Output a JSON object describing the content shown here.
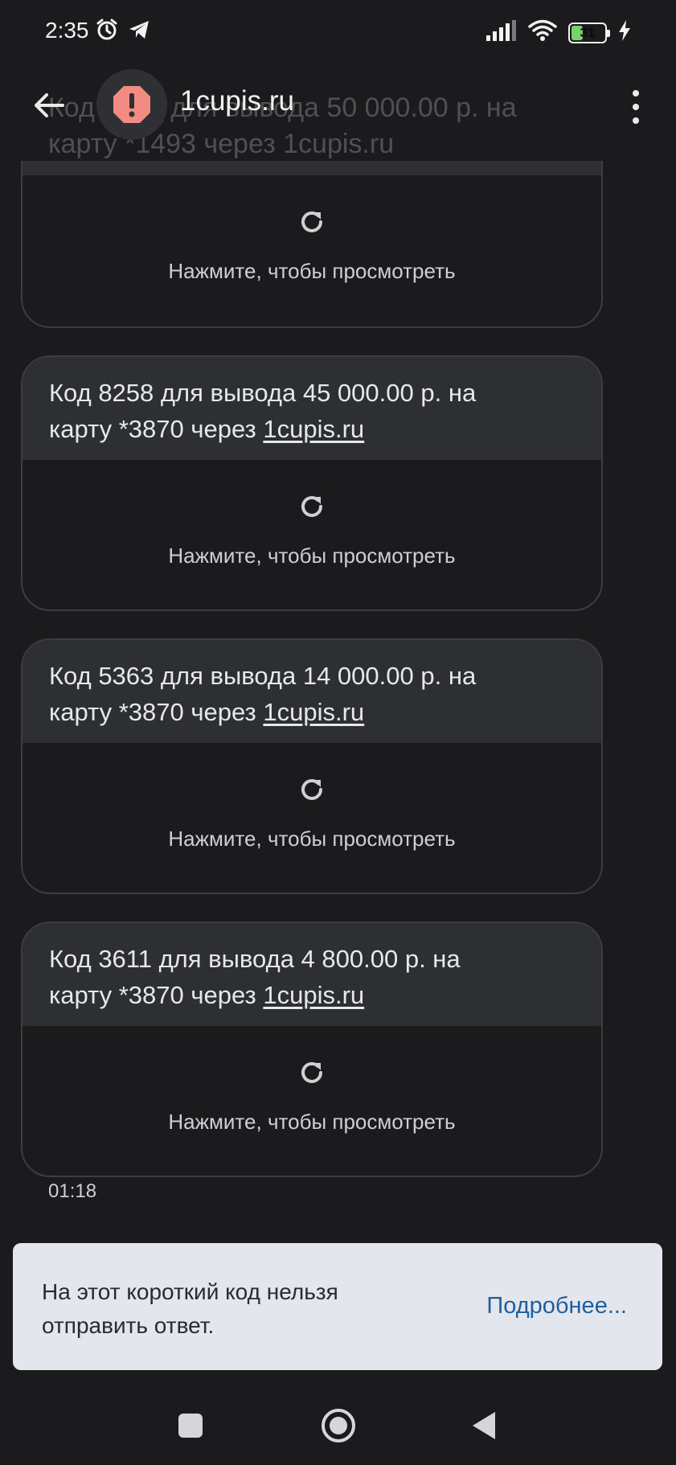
{
  "status_bar": {
    "time": "2:35",
    "battery": "31",
    "battery_level": 0.31,
    "icons": [
      "alarm-icon",
      "telegram-icon",
      "signal-icon",
      "wifi-icon",
      "battery-icon",
      "charging-icon"
    ]
  },
  "header": {
    "title": "1cupis.ru",
    "avatar_icon": "alert-octagon-icon",
    "avatar_color": "#f28b82",
    "ghost_text_line1": "Код ____ для вывода 50 000.00 р. на",
    "ghost_text_line2": "карту *1493 через 1cupis.ru"
  },
  "messages": [
    {
      "line1": "Код 8258 для вывода 45 000.00 р. на",
      "line2_prefix": "карту *3870 через ",
      "link": "1cupis.ru",
      "preview_label": "Нажмите, чтобы просмотреть"
    },
    {
      "line1": "Код 5363 для вывода 14 000.00 р. на",
      "line2_prefix": "карту *3870 через ",
      "link": "1cupis.ru",
      "preview_label": "Нажмите, чтобы просмотреть"
    },
    {
      "line1": "Код 3611 для вывода 4 800.00 р. на",
      "line2_prefix": "карту *3870 через ",
      "link": "1cupis.ru",
      "preview_label": "Нажмите, чтобы просмотреть"
    }
  ],
  "partial_message": {
    "preview_label": "Нажмите, чтобы просмотреть"
  },
  "timestamp": "01:18",
  "banner": {
    "text": "На этот короткий код нельзя отправить ответ.",
    "link": "Подробнее..."
  },
  "colors": {
    "background": "#1b1b1d",
    "bubble": "#2e2f32",
    "accent_link": "#1f5f99",
    "banner_bg": "#e4e6ee"
  }
}
